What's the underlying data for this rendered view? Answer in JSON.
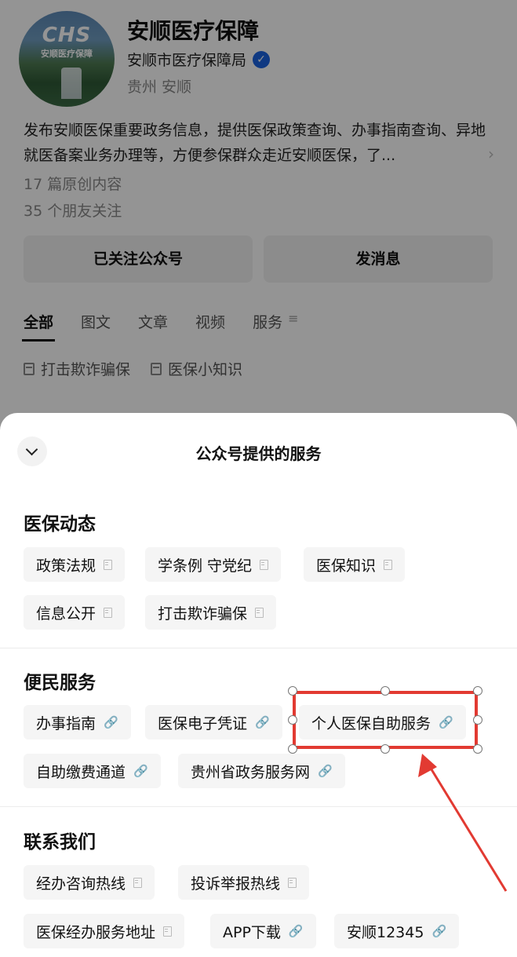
{
  "profile": {
    "avatar_logo": "CHS",
    "avatar_logo_sub": "安顺医疗保障",
    "name": "安顺医疗保障",
    "owner": "安顺市医疗保障局",
    "verified_glyph": "✓",
    "region": "贵州 安顺",
    "description": "发布安顺医保重要政务信息，提供医保政策查询、办事指南查询、异地就医备案业务办理等，方便参保群众走近安顺医保，了...",
    "description_more_glyph": "›",
    "original_count": "17 篇原创内容",
    "friends_following": "35 个朋友关注",
    "follow_button": "已关注公众号",
    "message_button": "发消息",
    "tabs": [
      "全部",
      "图文",
      "文章",
      "视频",
      "服务"
    ],
    "tab_menu_glyph": "≡",
    "shortcuts": [
      "打击欺诈骗保",
      "医保小知识"
    ]
  },
  "sheet": {
    "title": "公众号提供的服务",
    "sections": [
      {
        "title": "医保动态",
        "items": [
          {
            "label": "政策法规",
            "icon": "doc-icon"
          },
          {
            "label": "学条例 守党纪",
            "icon": "doc-icon"
          },
          {
            "label": "医保知识",
            "icon": "doc-icon"
          },
          {
            "label": "信息公开",
            "icon": "doc-icon"
          },
          {
            "label": "打击欺诈骗保",
            "icon": "doc-icon"
          }
        ]
      },
      {
        "title": "便民服务",
        "items": [
          {
            "label": "办事指南",
            "icon": "link-icon"
          },
          {
            "label": "医保电子凭证",
            "icon": "link-icon"
          },
          {
            "label": "个人医保自助服务",
            "icon": "link-icon"
          },
          {
            "label": "自助缴费通道",
            "icon": "link-icon"
          },
          {
            "label": "贵州省政务服务网",
            "icon": "link-icon"
          }
        ]
      },
      {
        "title": "联系我们",
        "items": [
          {
            "label": "经办咨询热线",
            "icon": "doc-icon"
          },
          {
            "label": "投诉举报热线",
            "icon": "doc-icon"
          },
          {
            "label": "医保经办服务地址",
            "icon": "doc-icon"
          },
          {
            "label": "APP下载",
            "icon": "link-icon"
          },
          {
            "label": "安顺12345",
            "icon": "link-icon"
          }
        ]
      }
    ]
  },
  "link_glyph": "🔗",
  "annotation": {
    "color": "#e23a32",
    "target": "个人医保自助服务"
  }
}
